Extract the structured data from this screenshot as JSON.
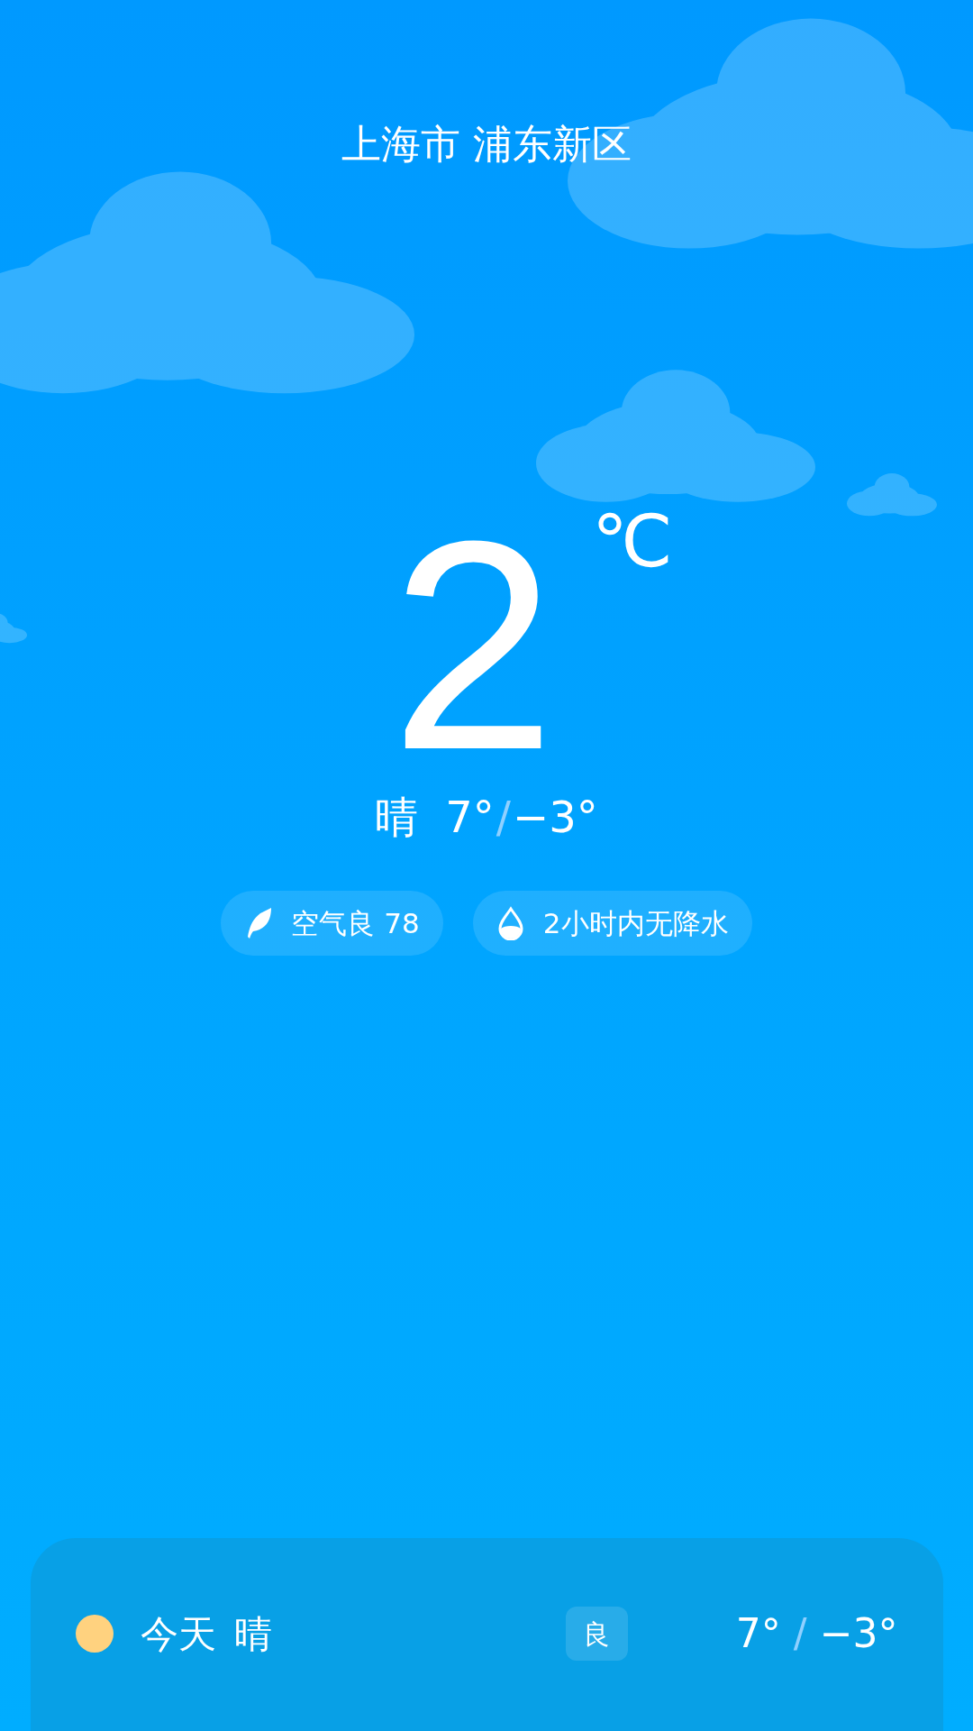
{
  "location": "上海市 浦东新区",
  "current": {
    "temp": "2",
    "unit": "℃",
    "condition": "晴",
    "high": "7°",
    "separator": "/",
    "low": "−3°"
  },
  "badges": [
    {
      "kind": "leaf",
      "text": "空气良 78"
    },
    {
      "kind": "drop",
      "text": "2小时内无降水"
    }
  ],
  "forecast": [
    {
      "kind": "sun",
      "color": "#ffd27f",
      "day": "今天",
      "condition": "晴",
      "aqi": "良",
      "high": "7°",
      "separator": "/",
      "low": "−3°"
    }
  ]
}
